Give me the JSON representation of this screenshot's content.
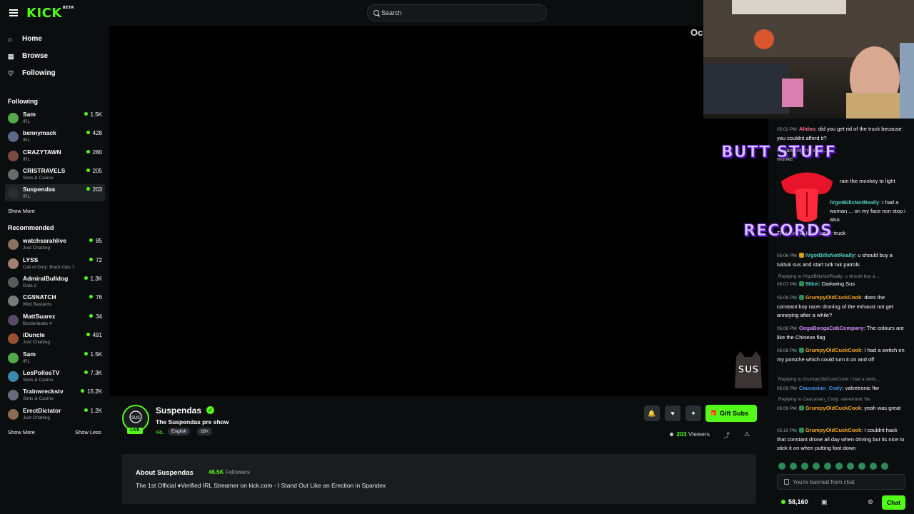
{
  "app": {
    "logo": "KICK",
    "logo_badge": "BETA",
    "brand_color": "#53fc18"
  },
  "search": {
    "placeholder": "Search"
  },
  "nav": [
    {
      "label": "Home"
    },
    {
      "label": "Browse"
    },
    {
      "label": "Following"
    }
  ],
  "following": {
    "title": "Following",
    "channels": [
      {
        "name": "Sam",
        "category": "IRL",
        "viewers": "1.5K"
      },
      {
        "name": "bennymack",
        "category": "IRL",
        "viewers": "428"
      },
      {
        "name": "CRAZYTAWN",
        "category": "IRL",
        "viewers": "280"
      },
      {
        "name": "CRISTRAVELS",
        "category": "Slots & Casino",
        "viewers": "205"
      },
      {
        "name": "Suspendas",
        "category": "IRL",
        "viewers": "203"
      }
    ],
    "show_more": "Show More"
  },
  "recommended": {
    "title": "Recommended",
    "channels": [
      {
        "name": "watchsarahlive",
        "category": "Just Chatting",
        "viewers": "85"
      },
      {
        "name": "LYSS",
        "category": "Call of Duty: Black Ops 7",
        "viewers": "72"
      },
      {
        "name": "AdmiralBulldog",
        "category": "Dota 2",
        "viewers": "1.3K"
      },
      {
        "name": "CG5NATCH",
        "category": "Wild Bastards",
        "viewers": "76"
      },
      {
        "name": "MattSuarez",
        "category": "Borderlands 4",
        "viewers": "34"
      },
      {
        "name": "iDuncle",
        "category": "Just Chatting",
        "viewers": "491"
      },
      {
        "name": "Sam",
        "category": "IRL",
        "viewers": "1.5K"
      },
      {
        "name": "LosPollosTV",
        "category": "Slots & Casino",
        "viewers": "7.3K"
      },
      {
        "name": "Trainwreckstv",
        "category": "Slots & Casino",
        "viewers": "15.2K"
      },
      {
        "name": "ErectDictator",
        "category": "Just Chatting",
        "viewers": "1.2K"
      }
    ],
    "show_more": "Show More",
    "show_less": "Show Less"
  },
  "video": {
    "corner_text": "Oc",
    "watermark": "SUS",
    "overlay_top": "BUTT STUFF",
    "overlay_bottom": "RECORDS"
  },
  "stream": {
    "channel": "Suspendas",
    "live": "LIVE",
    "title": "The Suspendas pre show",
    "category": "IRL",
    "tags": [
      "English",
      "18+"
    ],
    "gift_label": "Gift Subs",
    "viewers_count": "203",
    "viewers_label": "Viewers"
  },
  "about": {
    "title": "About Suspendas",
    "followers_count": "46.5K",
    "followers_label": "Followers",
    "bio": "The 1st Official ♦Verified IRL Streamer on kick.com - I Stand Out Like an Erection in Spandex"
  },
  "chat": {
    "messages": [
      {
        "time": "05:02 PM",
        "user": "Alidos",
        "color": "#ff6b8b",
        "text": ": did you get rid of the truck because you couldnt afford it?"
      },
      {
        "time": "05:06 PM",
        "user": "IVgotBillsNotReally",
        "color": "#4fd1c5",
        "text": ": u should buy a tuktuk sus and start tutk tuk patrols"
      },
      {
        "time": "05:07 PM",
        "user": "56kei",
        "color": "#4fd1c5",
        "text": ": Darkwing Sus"
      },
      {
        "time": "05:08 PM",
        "user": "GrumpyOldCuckCook",
        "color": "#f6a623",
        "text": ": does the constant boy racer droning of the exhaust not get annoying after a while?"
      },
      {
        "time": "05:08 PM",
        "user": "OogaBoogaCabCompany",
        "color": "#d58cff",
        "text": ": The colours are like the Chinese flag"
      },
      {
        "time": "05:08 PM",
        "user": "GrumpyOldCuckCook",
        "color": "#f6a623",
        "text": ": I had a switch on my porsche which could turn it on and off"
      },
      {
        "time": "05:09 PM",
        "user": "Caucasian_Cody",
        "color": "#4a90e2",
        "text": ": valvetronic ftw"
      },
      {
        "time": "05:09 PM",
        "user": "GrumpyOldCuckCook",
        "color": "#f6a623",
        "text": ": yeah was great"
      },
      {
        "time": "05:10 PM",
        "user": "GrumpyOldCuckCook",
        "color": "#f6a623",
        "text": ": I couldnt hack that constant drone all day when driving but its nice to stick it on when putting foot down"
      }
    ],
    "partial": [
      {
        "time": "",
        "user": "",
        "text": "I'm landing in South... monke"
      },
      {
        "time": "05",
        "user": "",
        "text": "rain the monkey to light"
      },
      {
        "time": "",
        "user": "IVgotBillsNotReally",
        "text": ": I had a woman ... on my face non stop i also"
      },
      {
        "time": "",
        "user": "",
        "text": "Thai Toyota Hilux baller truck"
      }
    ],
    "replies": [
      "Replying to IVgotBillsNotReally: u should buy a ...",
      "Replying to GrumpyOldCuckCook: i had a switc...",
      "Replying to Caucasian_Cody: valvetronic ftw"
    ],
    "banned_placeholder": "You're banned from chat",
    "points": "58,160",
    "send_label": "Chat"
  }
}
